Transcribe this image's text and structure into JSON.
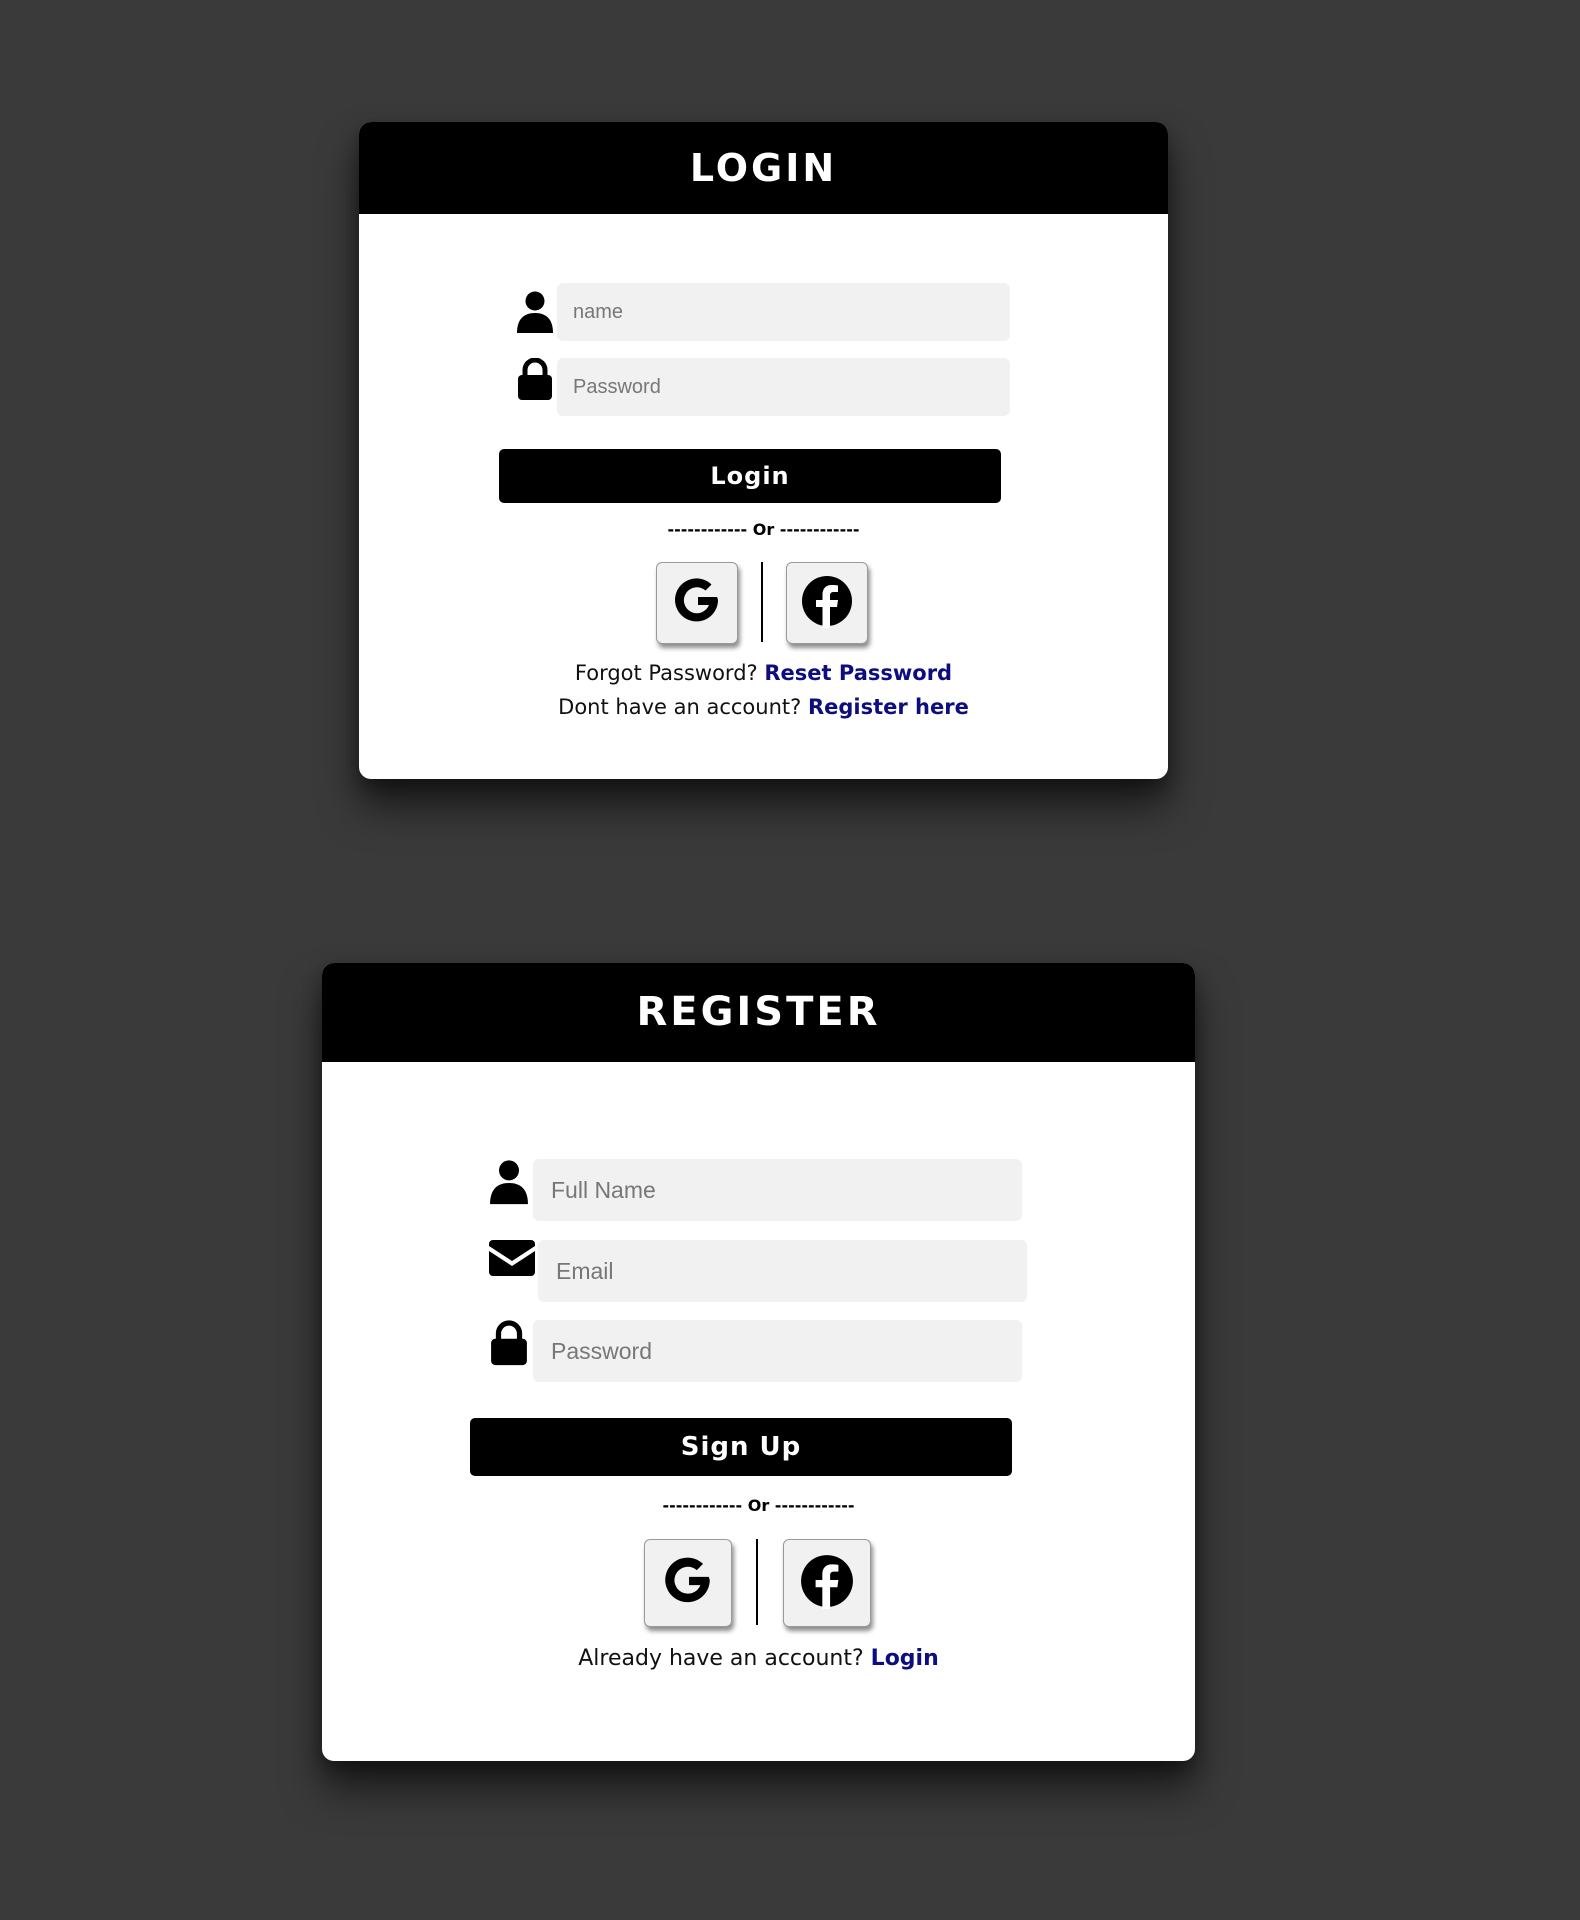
{
  "login": {
    "title": "LOGIN",
    "name_placeholder": "name",
    "password_placeholder": "Password",
    "submit_label": "Login",
    "divider": "------------ Or ------------",
    "forgot_text": "Forgot Password?",
    "reset_link": "Reset Password",
    "register_text": "Dont have an account?",
    "register_link": "Register here"
  },
  "register": {
    "title": "REGISTER",
    "fullname_placeholder": "Full Name",
    "email_placeholder": "Email",
    "password_placeholder": "Password",
    "submit_label": "Sign Up",
    "divider": "------------ Or ------------",
    "login_text": "Already have an account?",
    "login_link": "Login"
  },
  "icons": {
    "user": "user-icon",
    "lock": "lock-icon",
    "envelope": "envelope-icon",
    "google": "google-icon",
    "facebook": "facebook-icon"
  },
  "colors": {
    "background": "#3a3a3a",
    "card": "#ffffff",
    "header": "#000000",
    "input_bg": "#f1f1f1",
    "link": "#0d0d80"
  }
}
